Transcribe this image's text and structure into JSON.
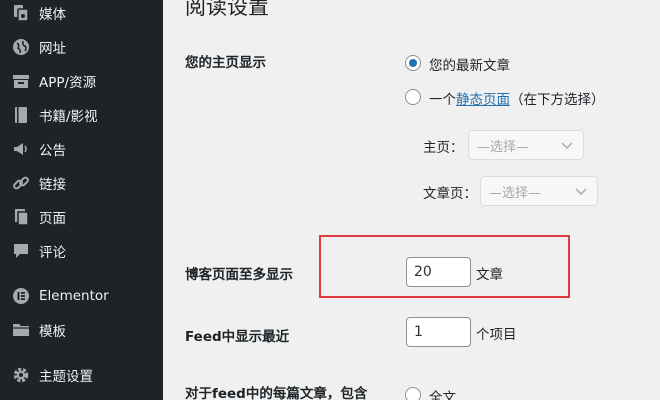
{
  "sidebar": {
    "items": [
      {
        "label": "媒体",
        "icon": "media-icon"
      },
      {
        "label": "网址",
        "icon": "globe-icon"
      },
      {
        "label": "APP/资源",
        "icon": "archive-icon"
      },
      {
        "label": "书籍/影视",
        "icon": "book-icon"
      },
      {
        "label": "公告",
        "icon": "megaphone-icon"
      },
      {
        "label": "链接",
        "icon": "link-icon"
      },
      {
        "label": "页面",
        "icon": "pages-icon"
      },
      {
        "label": "评论",
        "icon": "comment-icon"
      },
      {
        "label": "Elementor",
        "icon": "elementor-icon"
      },
      {
        "label": "模板",
        "icon": "folder-icon"
      },
      {
        "label": "主题设置",
        "icon": "gear-icon"
      }
    ]
  },
  "page": {
    "title": "阅读设置",
    "homepage": {
      "label": "您的主页显示",
      "option_latest": "您的最新文章",
      "option_static_prefix": "一个",
      "option_static_link": "静态页面",
      "option_static_suffix": "（在下方选择）",
      "selected": "latest",
      "front_label": "主页：",
      "front_value": "—选择—",
      "posts_label": "文章页：",
      "posts_value": "—选择—"
    },
    "posts_per_page": {
      "label": "博客页面至多显示",
      "value": "20",
      "unit": "文章"
    },
    "feed_count": {
      "label": "Feed中显示最近",
      "value": "1",
      "unit": "个项目"
    },
    "feed_content": {
      "label": "对于feed中的每篇文章，包含",
      "option_full": "全文"
    }
  },
  "colors": {
    "sidebar_bg": "#1d2327",
    "accent": "#2271b1",
    "highlight": "#e0393e"
  }
}
